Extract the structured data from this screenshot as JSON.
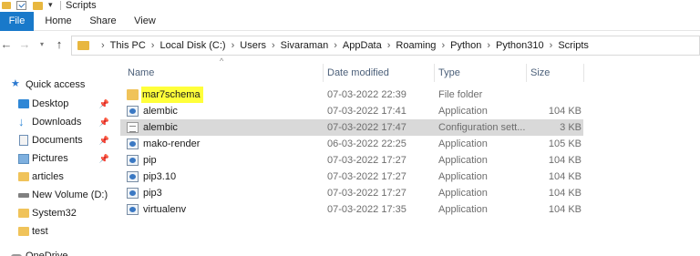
{
  "window": {
    "title": "Scripts"
  },
  "ribbon": {
    "tabs": [
      "File",
      "Home",
      "Share",
      "View"
    ]
  },
  "address": {
    "crumbs": [
      "This PC",
      "Local Disk (C:)",
      "Users",
      "Sivaraman",
      "AppData",
      "Roaming",
      "Python",
      "Python310",
      "Scripts"
    ]
  },
  "nav": {
    "items": [
      {
        "label": "Quick access",
        "icon": "star-icon"
      },
      {
        "label": "Desktop",
        "icon": "desktop-icon",
        "pinned": true
      },
      {
        "label": "Downloads",
        "icon": "download-icon",
        "pinned": true
      },
      {
        "label": "Documents",
        "icon": "documents-icon",
        "pinned": true
      },
      {
        "label": "Pictures",
        "icon": "pictures-icon",
        "pinned": true
      },
      {
        "label": "articles",
        "icon": "folder-icon"
      },
      {
        "label": "New Volume (D:)",
        "icon": "drive-icon"
      },
      {
        "label": "System32",
        "icon": "folder-icon"
      },
      {
        "label": "test",
        "icon": "folder-icon"
      },
      {
        "label": "OneDrive",
        "icon": "cloud-icon"
      }
    ]
  },
  "columns": {
    "name": "Name",
    "date": "Date modified",
    "type": "Type",
    "size": "Size"
  },
  "files": [
    {
      "name": "mar7schema",
      "date": "07-03-2022 22:39",
      "type": "File folder",
      "size": "",
      "icon": "folder-icon",
      "highlighted": true
    },
    {
      "name": "alembic",
      "date": "07-03-2022 17:41",
      "type": "Application",
      "size": "104 KB",
      "icon": "application-icon"
    },
    {
      "name": "alembic",
      "date": "07-03-2022 17:47",
      "type": "Configuration sett...",
      "size": "3 KB",
      "icon": "config-file-icon",
      "selected": true
    },
    {
      "name": "mako-render",
      "date": "06-03-2022 22:25",
      "type": "Application",
      "size": "105 KB",
      "icon": "application-icon"
    },
    {
      "name": "pip",
      "date": "07-03-2022 17:27",
      "type": "Application",
      "size": "104 KB",
      "icon": "application-icon"
    },
    {
      "name": "pip3.10",
      "date": "07-03-2022 17:27",
      "type": "Application",
      "size": "104 KB",
      "icon": "application-icon"
    },
    {
      "name": "pip3",
      "date": "07-03-2022 17:27",
      "type": "Application",
      "size": "104 KB",
      "icon": "application-icon"
    },
    {
      "name": "virtualenv",
      "date": "07-03-2022 17:35",
      "type": "Application",
      "size": "104 KB",
      "icon": "application-icon"
    }
  ],
  "colors": {
    "file_tab": "#1979ca",
    "highlight": "#ffff3a",
    "selection": "#d9d9d9"
  }
}
